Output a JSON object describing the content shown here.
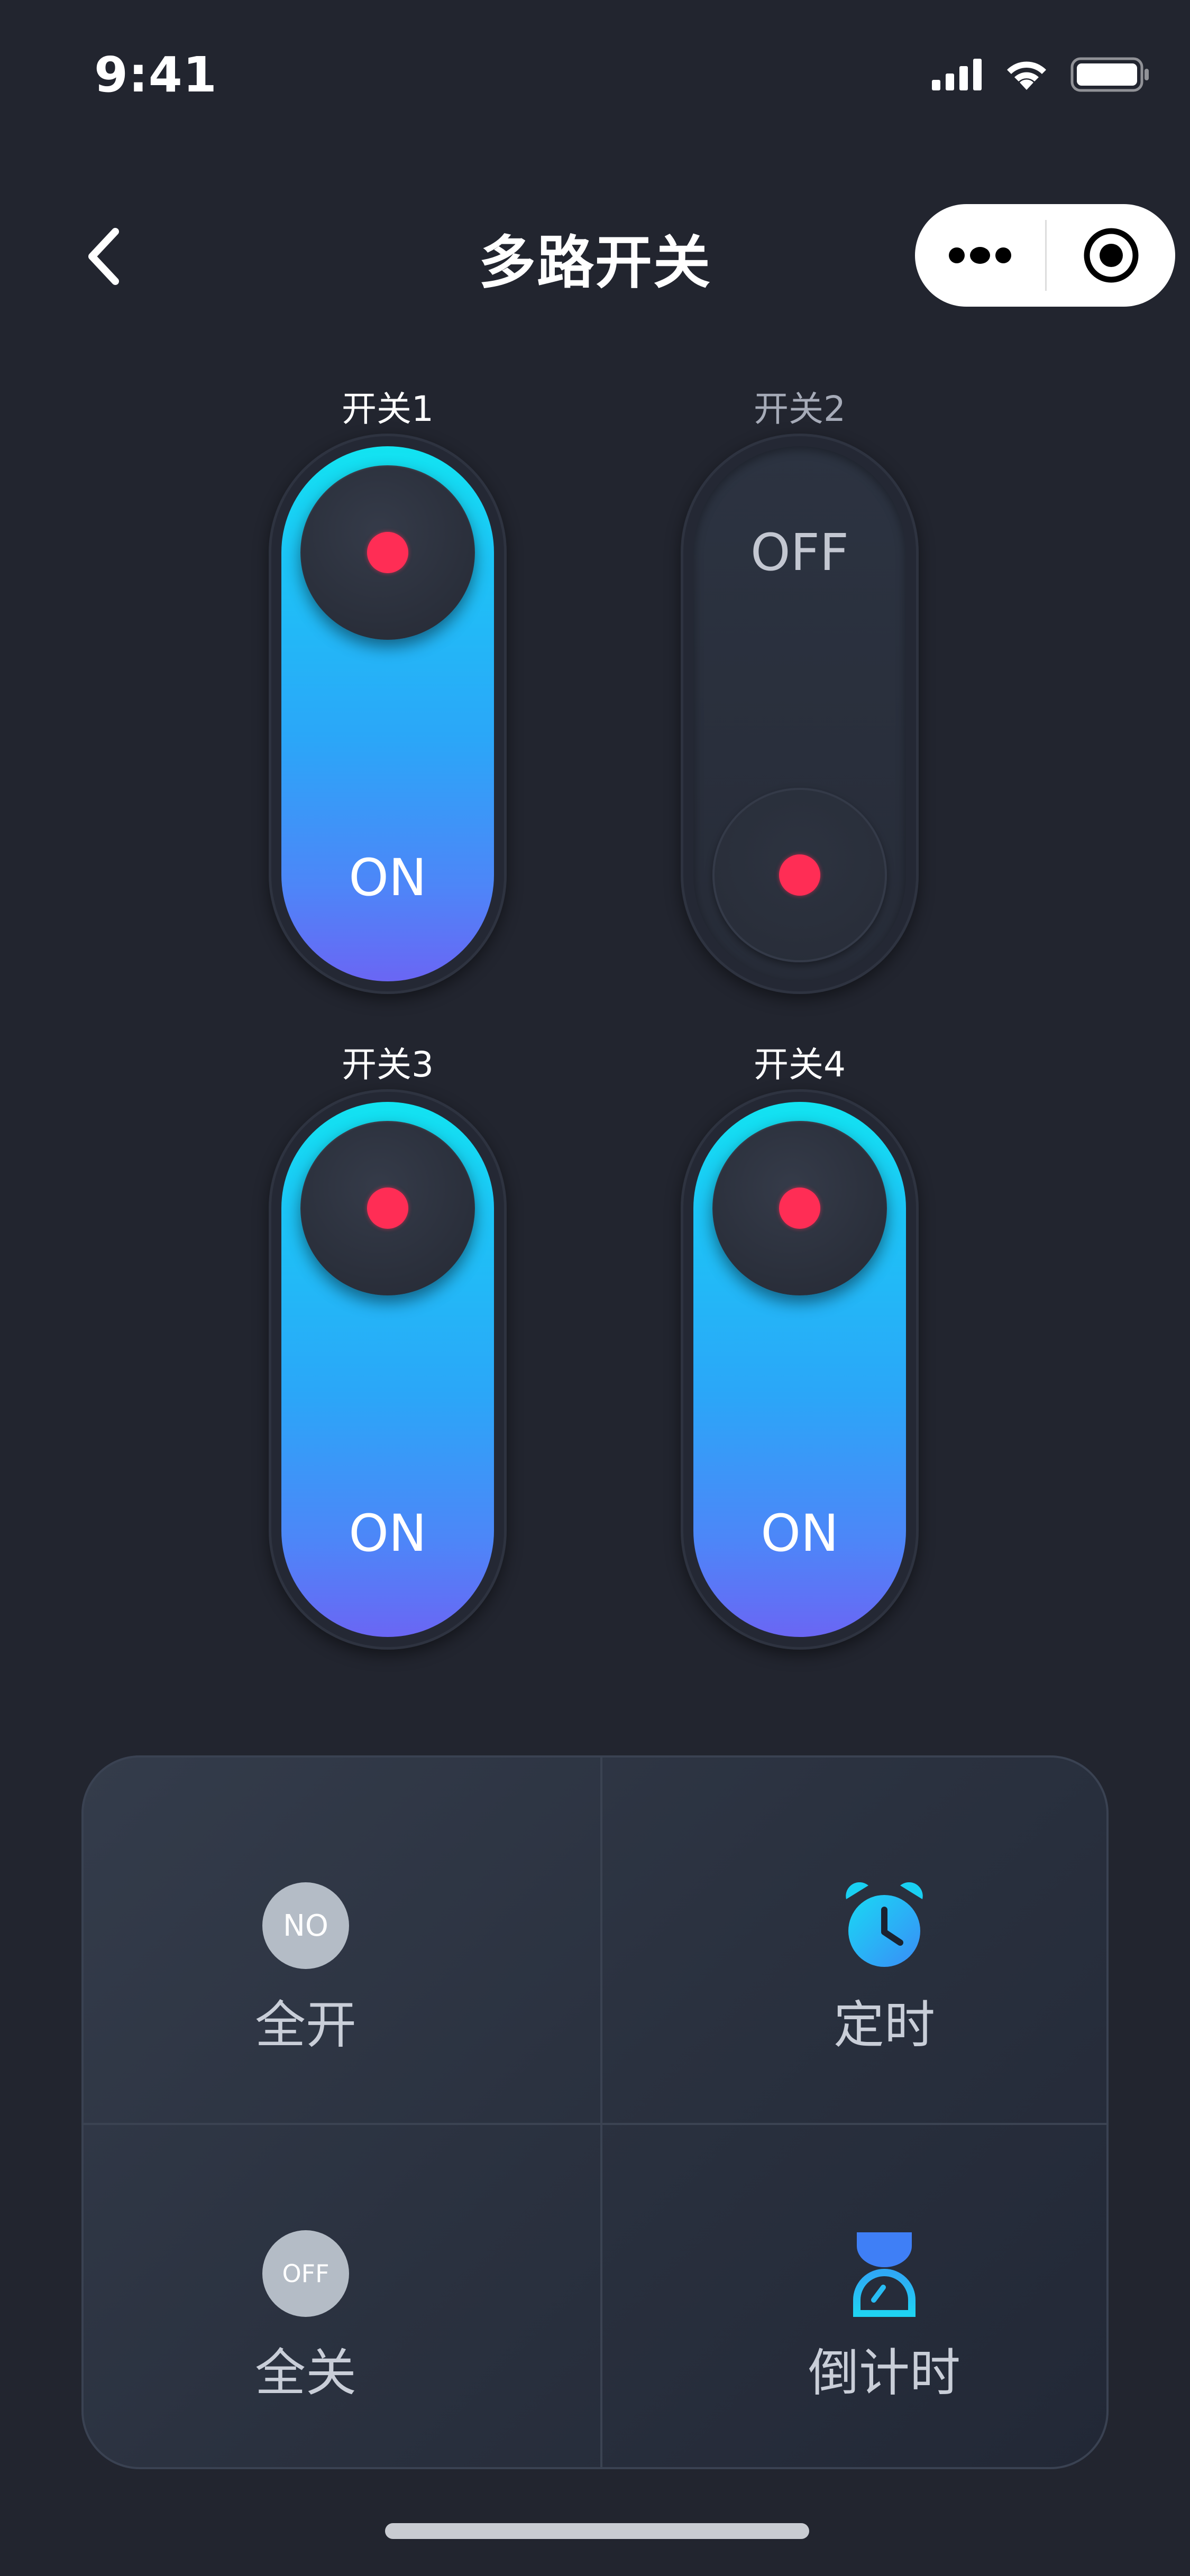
{
  "status_bar": {
    "time": "9:41",
    "icons": [
      "signal-icon",
      "wifi-icon",
      "battery-icon"
    ]
  },
  "nav": {
    "title": "多路开关",
    "back_icon": "chevron-left-icon",
    "more_icon": "more-dots-icon",
    "close_icon": "target-close-icon"
  },
  "switches": [
    {
      "label": "开关1",
      "state": "ON",
      "on": true
    },
    {
      "label": "开关2",
      "state": "OFF",
      "on": false
    },
    {
      "label": "开关3",
      "state": "ON",
      "on": true
    },
    {
      "label": "开关4",
      "state": "ON",
      "on": true
    }
  ],
  "panel": {
    "all_on": {
      "badge": "NO",
      "label": "全开"
    },
    "timer": {
      "label": "定时",
      "icon": "alarm-clock-icon"
    },
    "all_off": {
      "badge": "OFF",
      "label": "全关"
    },
    "countdown": {
      "label": "倒计时",
      "icon": "hourglass-icon"
    }
  },
  "colors": {
    "background": "#22252f",
    "switch_on_top": "#12e4f1",
    "switch_on_bottom": "#6a66f4",
    "indicator_dot": "#ff2d55"
  }
}
